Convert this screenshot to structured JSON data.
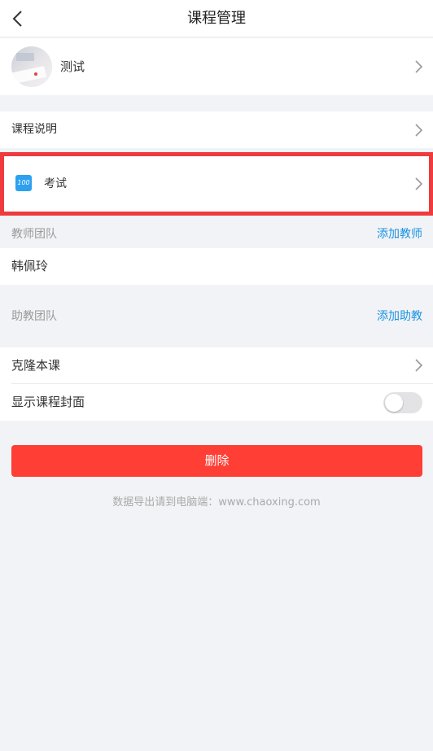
{
  "header": {
    "title": "课程管理"
  },
  "course": {
    "name": "测试"
  },
  "rows": {
    "description_label": "课程说明",
    "exam_label": "考试",
    "exam_icon_text": "100"
  },
  "teacher_team": {
    "title": "教师团队",
    "action": "添加教师",
    "members": [
      "韩佩玲"
    ]
  },
  "assistant_team": {
    "title": "助教团队",
    "action": "添加助教"
  },
  "settings": {
    "clone_label": "克隆本课",
    "show_cover_label": "显示课程封面",
    "show_cover_enabled": false
  },
  "actions": {
    "delete_label": "删除"
  },
  "footer": {
    "note": "数据导出请到电脑端：www.chaoxing.com"
  },
  "colors": {
    "accent_blue": "#1a93e3",
    "danger_red": "#ff3e35",
    "highlight_red": "#ef3a3e"
  }
}
